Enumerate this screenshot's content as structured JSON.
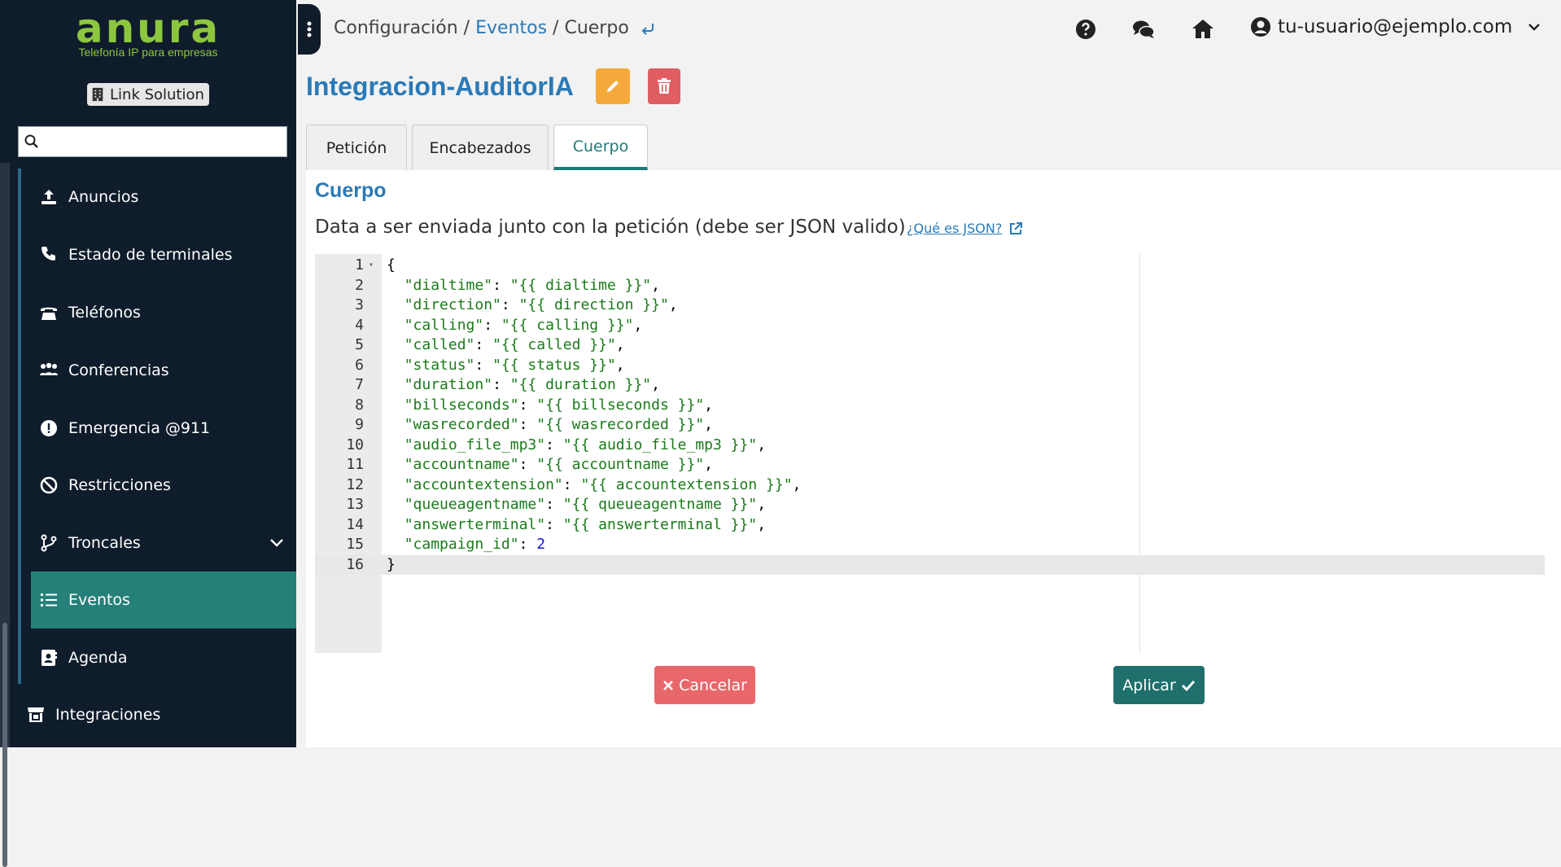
{
  "sidebar": {
    "logo": {
      "word": "anura",
      "tagline": "Telefonía IP para empresas"
    },
    "company": "Link Solution",
    "search": {
      "placeholder": "",
      "value": ""
    },
    "items": [
      {
        "label": "Anuncios",
        "icon": "upload-icon"
      },
      {
        "label": "Estado de terminales",
        "icon": "phone-icon"
      },
      {
        "label": "Teléfonos",
        "icon": "desk-phone-icon"
      },
      {
        "label": "Conferencias",
        "icon": "people-group-icon"
      },
      {
        "label": "Emergencia @911",
        "icon": "alert-circle-icon"
      },
      {
        "label": "Restricciones",
        "icon": "ban-icon"
      },
      {
        "label": "Troncales",
        "icon": "branch-icon"
      },
      {
        "label": "Eventos",
        "icon": "list-icon",
        "active": true
      },
      {
        "label": "Agenda",
        "icon": "contact-book-icon"
      },
      {
        "label": "Integraciones",
        "icon": "store-icon"
      }
    ]
  },
  "header": {
    "breadcrumb": {
      "part1": "Configuración",
      "sep1": "/",
      "part2": "Eventos",
      "sep2": "/",
      "part3": "Cuerpo"
    },
    "user": "tu-usuario@ejemplo.com"
  },
  "page": {
    "title": "Integracion-AuditorIA",
    "tabs": [
      "Petición",
      "Encabezados",
      "Cuerpo"
    ],
    "active_tab": "Cuerpo"
  },
  "body_section": {
    "title": "Cuerpo",
    "description": "Data a ser enviada junto con la petición (debe ser JSON valido)",
    "json_link": "¿Qué es JSON?"
  },
  "editor": {
    "lines": [
      {
        "n": "1",
        "pre": "{",
        "key": "",
        "mid": "",
        "val": "",
        "post": "",
        "type": "none"
      },
      {
        "n": "2",
        "pre": "  ",
        "key": "\"dialtime\"",
        "mid": ": ",
        "val": "\"{{ dialtime }}\"",
        "post": ",",
        "type": "str"
      },
      {
        "n": "3",
        "pre": "  ",
        "key": "\"direction\"",
        "mid": ": ",
        "val": "\"{{ direction }}\"",
        "post": ",",
        "type": "str"
      },
      {
        "n": "4",
        "pre": "  ",
        "key": "\"calling\"",
        "mid": ": ",
        "val": "\"{{ calling }}\"",
        "post": ",",
        "type": "str"
      },
      {
        "n": "5",
        "pre": "  ",
        "key": "\"called\"",
        "mid": ": ",
        "val": "\"{{ called }}\"",
        "post": ",",
        "type": "str"
      },
      {
        "n": "6",
        "pre": "  ",
        "key": "\"status\"",
        "mid": ": ",
        "val": "\"{{ status }}\"",
        "post": ",",
        "type": "str"
      },
      {
        "n": "7",
        "pre": "  ",
        "key": "\"duration\"",
        "mid": ": ",
        "val": "\"{{ duration }}\"",
        "post": ",",
        "type": "str"
      },
      {
        "n": "8",
        "pre": "  ",
        "key": "\"billseconds\"",
        "mid": ": ",
        "val": "\"{{ billseconds }}\"",
        "post": ",",
        "type": "str"
      },
      {
        "n": "9",
        "pre": "  ",
        "key": "\"wasrecorded\"",
        "mid": ": ",
        "val": "\"{{ wasrecorded }}\"",
        "post": ",",
        "type": "str"
      },
      {
        "n": "10",
        "pre": "  ",
        "key": "\"audio_file_mp3\"",
        "mid": ": ",
        "val": "\"{{ audio_file_mp3 }}\"",
        "post": ",",
        "type": "str"
      },
      {
        "n": "11",
        "pre": "  ",
        "key": "\"accountname\"",
        "mid": ": ",
        "val": "\"{{ accountname }}\"",
        "post": ",",
        "type": "str"
      },
      {
        "n": "12",
        "pre": "  ",
        "key": "\"accountextension\"",
        "mid": ": ",
        "val": "\"{{ accountextension }}\"",
        "post": ",",
        "type": "str"
      },
      {
        "n": "13",
        "pre": "  ",
        "key": "\"queueagentname\"",
        "mid": ": ",
        "val": "\"{{ queueagentname }}\"",
        "post": ",",
        "type": "str"
      },
      {
        "n": "14",
        "pre": "  ",
        "key": "\"answerterminal\"",
        "mid": ": ",
        "val": "\"{{ answerterminal }}\"",
        "post": ",",
        "type": "str"
      },
      {
        "n": "15",
        "pre": "  ",
        "key": "\"campaign_id\"",
        "mid": ": ",
        "val": "2",
        "post": "",
        "type": "num"
      },
      {
        "n": "16",
        "pre": "}",
        "key": "",
        "mid": "",
        "val": "",
        "post": "",
        "type": "none"
      }
    ]
  },
  "actions": {
    "cancel": "Cancelar",
    "apply": "Aplicar"
  },
  "colors": {
    "sidebar_bg": "#0f1c2b",
    "accent": "#2a7ab8",
    "teal": "#1f6f6c",
    "logo_green": "#8cc63f",
    "edit": "#f5a93b",
    "delete": "#e05d62"
  }
}
